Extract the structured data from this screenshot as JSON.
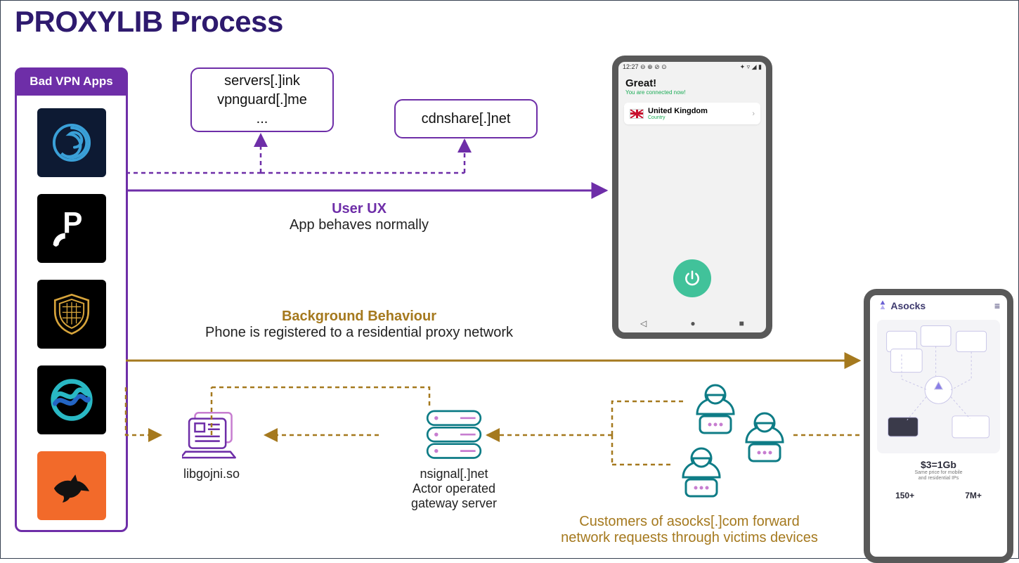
{
  "title": "PROXYLIB Process",
  "colors": {
    "purple": "#6e2ea8",
    "gold": "#a5791e",
    "teal": "#0e7c86",
    "pink": "#c77dd0"
  },
  "bad_apps": {
    "header": "Bad VPN Apps",
    "count": 5
  },
  "domain_boxes": {
    "top": {
      "line1": "servers[.]ink",
      "line2": "vpnguard[.]me",
      "line3": "..."
    },
    "right": {
      "line1": "cdnshare[.]net"
    }
  },
  "labels": {
    "ux": {
      "title": "User UX",
      "sub": "App behaves normally"
    },
    "bg": {
      "title": "Background Behaviour",
      "sub": "Phone is registered to a residential proxy network"
    }
  },
  "nodes": {
    "laptop": {
      "label": "libgojni.so"
    },
    "server": {
      "label": "nsignal[.]net",
      "sub1": "Actor operated",
      "sub2": "gateway server"
    }
  },
  "customers_text": "Customers of asocks[.]com forward\nnetwork requests through victims devices",
  "phone_ux": {
    "status_left": "12:27 ⊖ ⊕ ⊘ ⊙",
    "status_right": "✦ ▿ ◢ ▮",
    "title": "Great!",
    "connected": "You are connected now!",
    "country": "United Kingdom",
    "country_sub": "Country",
    "nav": [
      "◁",
      "●",
      "■"
    ]
  },
  "phone_asocks": {
    "brand": "Asocks",
    "price": "$3=1Gb",
    "price_sub": "Same price for mobile\nand residential IPs",
    "stat1": "150+",
    "stat2": "7M+"
  }
}
